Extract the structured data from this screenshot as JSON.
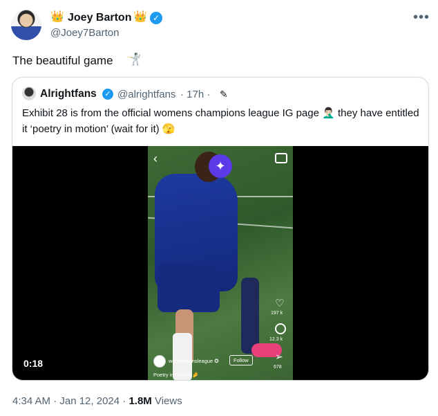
{
  "tweet": {
    "author_name": "Joey Barton",
    "author_handle": "@Joey7Barton",
    "name_emoji": "👑",
    "text": "The beautiful game",
    "text_emoji": "🤺",
    "more": "•••"
  },
  "quote": {
    "name": "Alrightfans",
    "handle": "@alrightfans",
    "time": "· 17h ·",
    "text": "Exhibit 28 is from the official womens champions league IG page 🤦🏻‍♂️ they have entitled it ‘poetry in motion’ (wait for it) 🫣",
    "video": {
      "duration": "0:18",
      "ig_likes": "197 k",
      "ig_comments": "12.3 k",
      "ig_shares": "678",
      "ig_account": "wchampionsleague ✪",
      "ig_follow": "Follow",
      "ig_caption": "Poetry in motion 🤌"
    }
  },
  "footer": {
    "timestamp": "4:34 AM · Jan 12, 2024 · ",
    "views_count": "1.8M",
    "views_label": " Views"
  },
  "colors": {
    "verified": "#1d9bf0",
    "muted": "#536471",
    "border": "#cfd9de"
  }
}
